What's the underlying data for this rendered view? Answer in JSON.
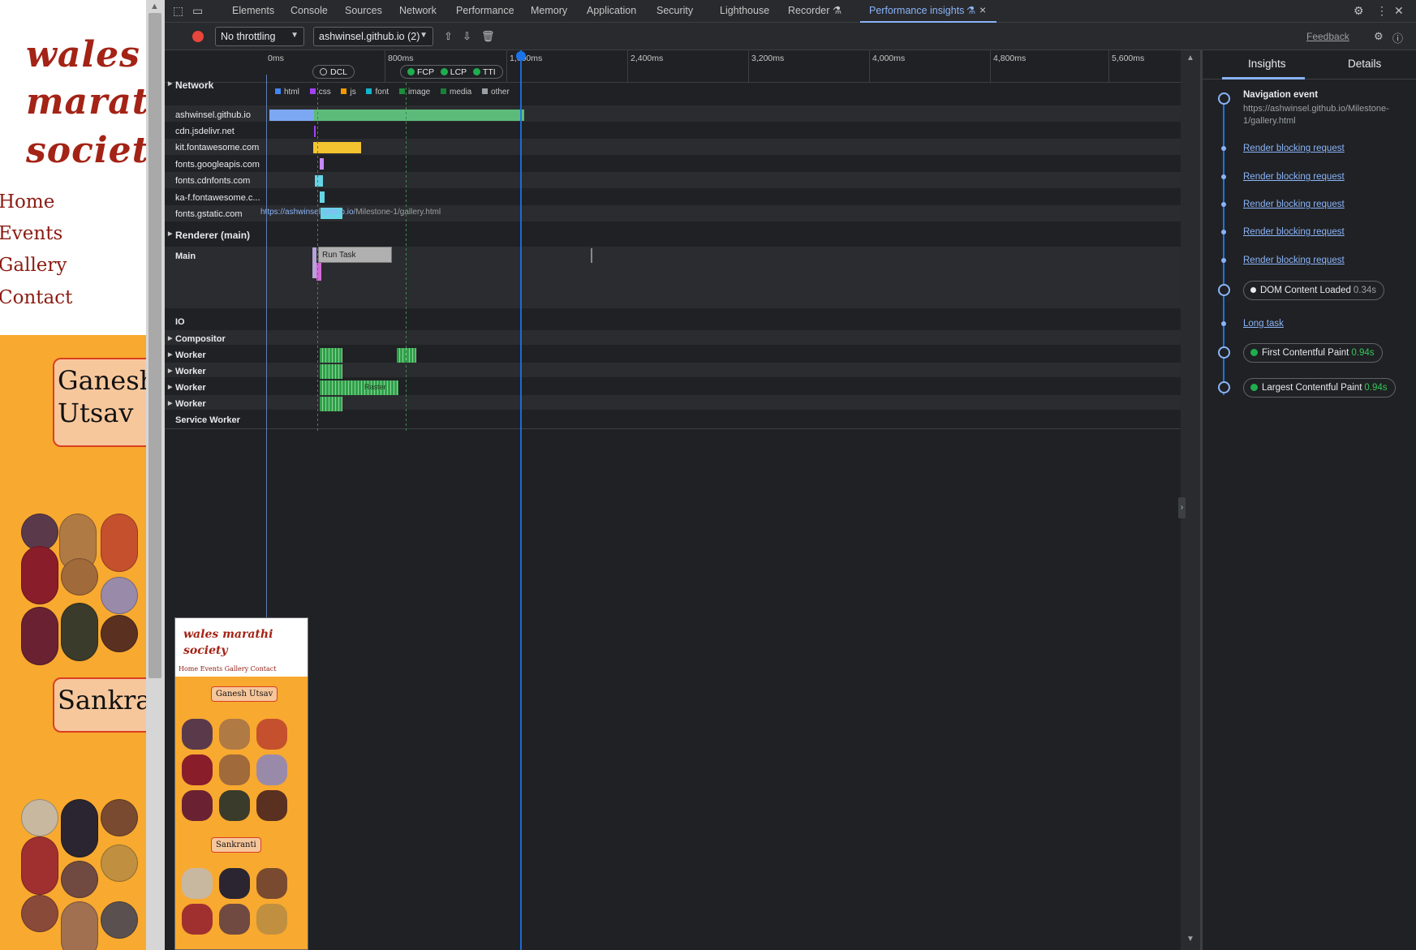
{
  "webpage": {
    "brand_lines": [
      "wales",
      "marathi",
      "society"
    ],
    "nav": [
      "Home",
      "Events",
      "Gallery",
      "Contact"
    ],
    "events": [
      "Ganesh Utsav",
      "Sankranti"
    ]
  },
  "devtools": {
    "tabs": [
      "Elements",
      "Console",
      "Sources",
      "Network",
      "Performance",
      "Memory",
      "Application",
      "Security",
      "Lighthouse",
      "Recorder",
      "Performance insights"
    ],
    "active_tab": "Performance insights",
    "toolbar": {
      "throttling": "No throttling",
      "recording": "ashwinsel.github.io (2)",
      "feedback": "Feedback"
    },
    "ruler_ticks": [
      "0ms",
      "800ms",
      "1,600ms",
      "2,400ms",
      "3,200ms",
      "4,000ms",
      "4,800ms",
      "5,600ms"
    ],
    "markers": {
      "dcl": "DCL",
      "fcp": "FCP",
      "lcp": "LCP",
      "tti": "TTI"
    },
    "network": {
      "title": "Network",
      "legend": [
        {
          "label": "html",
          "color": "#4285f4"
        },
        {
          "label": "css",
          "color": "#a142f4"
        },
        {
          "label": "js",
          "color": "#f29900"
        },
        {
          "label": "font",
          "color": "#12b5cb"
        },
        {
          "label": "image",
          "color": "#1e8e3e"
        },
        {
          "label": "media",
          "color": "#188038"
        },
        {
          "label": "other",
          "color": "#9aa0a6"
        }
      ],
      "hosts": [
        "ashwinsel.github.io",
        "cdn.jsdelivr.net",
        "kit.fontawesome.com",
        "fonts.googleapis.com",
        "fonts.cdnfonts.com",
        "ka-f.fontawesome.c...",
        "fonts.gstatic.com"
      ]
    },
    "renderer": {
      "title": "Renderer (main)",
      "url_host": "https://ashwinsel.github.io",
      "url_path": "/Milestone-1/gallery.html",
      "main": "Main",
      "run_task": "Run Task"
    },
    "threads": [
      "IO",
      "Compositor",
      "Worker",
      "Worker",
      "Worker",
      "Worker",
      "Service Worker"
    ],
    "raster_label": "Raster",
    "thumbnail": {
      "brand": [
        "wales marathi",
        "society"
      ],
      "nav": "Home  Events  Gallery  Contact",
      "events": [
        "Ganesh Utsav",
        "Sankranti"
      ]
    },
    "insights": {
      "tabs": [
        "Insights",
        "Details"
      ],
      "nav_title": "Navigation event",
      "nav_url": "https://ashwinsel.github.io/Milestone-1/gallery.html",
      "render_blocking": [
        "Render blocking request",
        "Render blocking request",
        "Render blocking request",
        "Render blocking request",
        "Render blocking request"
      ],
      "dcl": {
        "label": "DOM Content Loaded",
        "time": "0.34s"
      },
      "long_task": "Long task",
      "fcp": {
        "label": "First Contentful Paint",
        "time": "0.94s"
      },
      "lcp": {
        "label": "Largest Contentful Paint",
        "time": "0.94s"
      }
    }
  }
}
